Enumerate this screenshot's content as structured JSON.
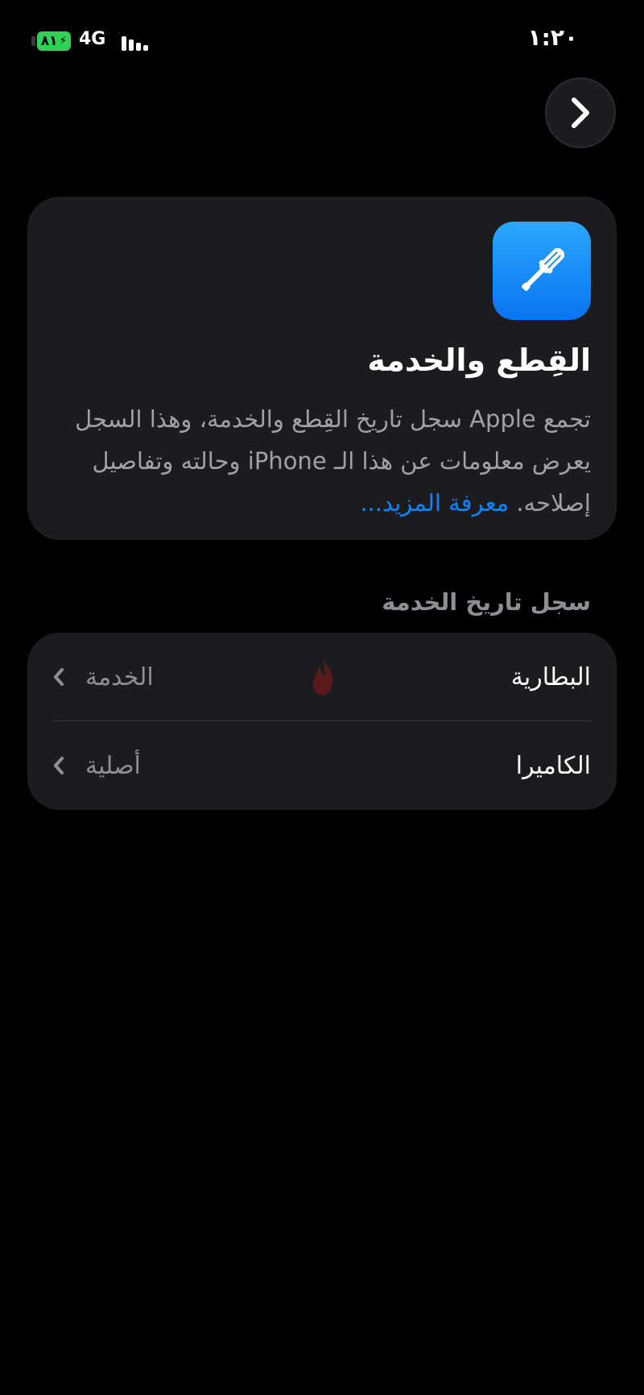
{
  "status_bar": {
    "battery_level": "٨١",
    "network": "4G",
    "time": "١:٢٠"
  },
  "colors": {
    "background": "#000000",
    "card": "#1c1c1e",
    "accent": "#0a84ff",
    "battery": "#30d158",
    "secondary_text": "#8e8e93"
  },
  "nav": {
    "icon": "chevron-right-icon"
  },
  "info_card": {
    "icon": "screwdriver-icon",
    "title": "القِطع والخدمة",
    "description": "تجمع Apple سجل تاريخ القِطع والخدمة، وهذا السجل يعرض معلومات عن هذا الـ iPhone وحالته وتفاصيل إصلاحه.",
    "link": "معرفة المزيد..."
  },
  "service_history": {
    "header": "سجل تاريخ الخدمة",
    "rows": [
      {
        "label": "البطارية",
        "value": "الخدمة"
      },
      {
        "label": "الكاميرا",
        "value": "أصلية"
      }
    ]
  }
}
